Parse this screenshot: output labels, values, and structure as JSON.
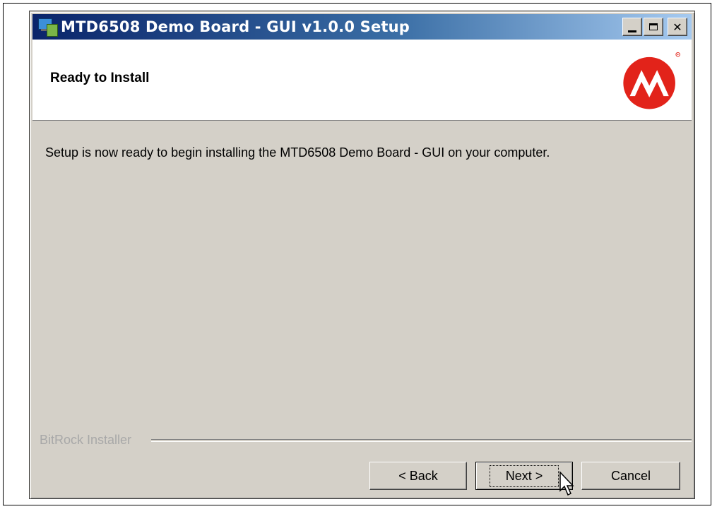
{
  "window": {
    "title": "MTD6508 Demo Board - GUI v1.0.0 Setup",
    "controls": [
      "minimize",
      "maximize",
      "close"
    ]
  },
  "header": {
    "title": "Ready to Install",
    "logo": "microchip-logo"
  },
  "body": {
    "message": "Setup is now ready to begin installing the MTD6508 Demo Board - GUI on your computer."
  },
  "footer": {
    "installer_label": "BitRock Installer",
    "buttons": {
      "back": "< Back",
      "next": "Next >",
      "cancel": "Cancel"
    }
  },
  "colors": {
    "titlebar_start": "#0a246a",
    "titlebar_end": "#a6caf0",
    "dialog_bg": "#d4d0c8",
    "logo_red": "#e2231a"
  }
}
